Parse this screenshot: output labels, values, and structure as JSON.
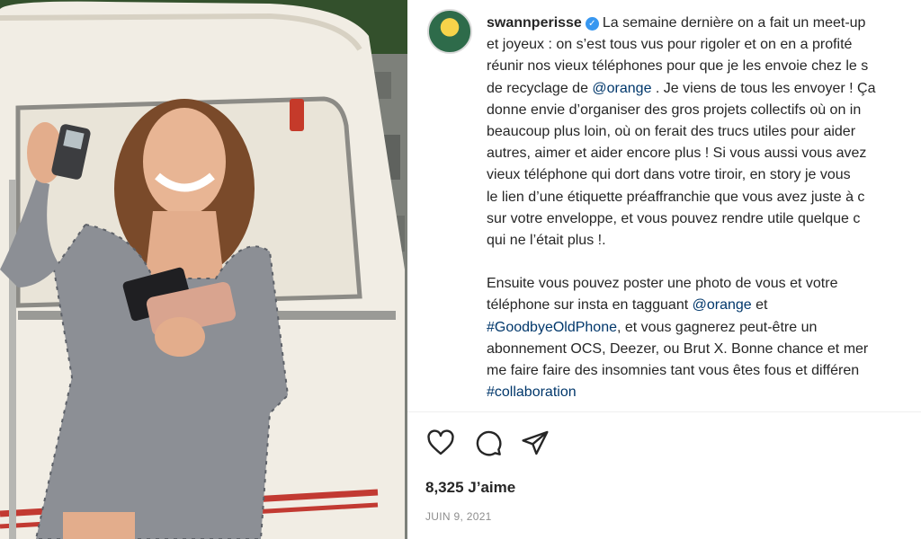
{
  "photo": {
    "alt": "Woman holding old phones in front of a vintage caravan"
  },
  "post": {
    "username": "swannperisse",
    "verified_glyph": "✓",
    "caption": {
      "p1": [
        [
          "La semaine dernière on a fait un meet-up"
        ],
        [
          "et joyeux : on s’est tous vus pour rigoler et on en a profité"
        ],
        [
          "réunir nos vieux téléphones pour que je les envoie chez le s"
        ],
        [
          "de recyclage de ",
          "@orange",
          " . Je viens de tous les envoyer ! Ça"
        ],
        [
          "donne envie d’organiser des gros projets collectifs où on in"
        ],
        [
          "beaucoup plus loin, où on ferait des trucs utiles pour aider"
        ],
        [
          "autres, aimer et aider encore plus ! Si vous aussi vous avez"
        ],
        [
          "vieux téléphone qui dort dans votre tiroir, en story je vous"
        ],
        [
          "le lien d’une étiquette préaffranchie que vous avez juste à c"
        ],
        [
          "sur votre enveloppe, et vous pouvez rendre utile quelque c"
        ],
        [
          "qui ne l’était plus !."
        ]
      ],
      "p2": {
        "l1": "Ensuite vous pouvez poster une photo de vous et votre",
        "l2_pre": "téléphone sur insta en tagguant ",
        "l2_mention": "@orange",
        "l2_post": " et",
        "l3_tag": "#GoodbyeOldPhone",
        "l3_post": ", et vous gagnerez peut-être un",
        "l4": "abonnement OCS, Deezer, ou Brut X. Bonne chance et mer",
        "l5": "me faire faire des insomnies tant vous êtes fous et différen",
        "l6_tag": "#collaboration"
      }
    },
    "actions": {
      "like_icon": "heart-icon",
      "comment_icon": "comment-icon",
      "share_icon": "share-icon"
    },
    "likes": "8,325 J’aime",
    "date": "JUIN 9, 2021"
  }
}
